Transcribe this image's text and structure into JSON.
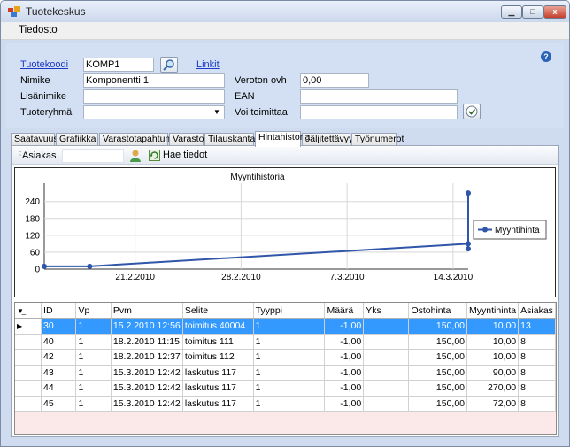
{
  "window": {
    "title": "Tuotekeskus",
    "minimize": "▁",
    "maximize": "□",
    "close": "x"
  },
  "menu": {
    "file": "Tiedosto"
  },
  "form": {
    "product_code_label": "Tuotekoodi",
    "product_code_value": "KOMP1",
    "links_label": "Linkit",
    "name_label": "Nimike",
    "name_value": "Komponentti 1",
    "extra_name_label": "Lisänimike",
    "extra_name_value": "",
    "group_label": "Tuoteryhmä",
    "group_value": "",
    "price_label": "Veroton ovh",
    "price_value": "0,00",
    "ean_label": "EAN",
    "ean_value": "",
    "supplier_label": "Voi toimittaa",
    "supplier_value": "",
    "help": "?"
  },
  "tabs": [
    "Saatavuus",
    "Grafiikka",
    "Varastotapahtumat",
    "Varastot",
    "Tilauskanta",
    "Hintahistoria",
    "Jäljitettävyys",
    "Työnumerot"
  ],
  "toolbar": {
    "customer_label": "Asiakas",
    "fetch_label": "Hae tiedot"
  },
  "chart_data": {
    "type": "line",
    "title": "Myyntihistoria",
    "x_labels": [
      "21.2.2010",
      "28.2.2010",
      "7.3.2010",
      "14.3.2010"
    ],
    "y_ticks": [
      0,
      60,
      120,
      180,
      240
    ],
    "ylim": [
      0,
      280
    ],
    "xlim": [
      "15.2.2010",
      "15.3.2010"
    ],
    "grid": true,
    "legend": "right",
    "series": [
      {
        "name": "Myyntihinta",
        "color": "#2f56a8",
        "points": [
          {
            "x": "15.2.2010",
            "y": 10
          },
          {
            "x": "18.2.2010",
            "y": 10
          },
          {
            "x": "15.3.2010",
            "y": 90
          },
          {
            "x": "15.3.2010",
            "y": 270
          },
          {
            "x": "15.3.2010",
            "y": 72
          }
        ]
      }
    ]
  },
  "table": {
    "columns": [
      "ID",
      "Vp",
      "Pvm",
      "Selite",
      "Tyyppi",
      "Määrä",
      "Yks",
      "Ostohinta",
      "Myyntihinta",
      "Asiakas"
    ],
    "rows": [
      [
        "30",
        "1",
        "15.2.2010 12:56",
        "toimitus 40004",
        "1",
        "-1,00",
        "",
        "150,00",
        "10,00",
        "13"
      ],
      [
        "40",
        "1",
        "18.2.2010 11:15",
        "toimitus 111",
        "1",
        "-1,00",
        "",
        "150,00",
        "10,00",
        "8"
      ],
      [
        "42",
        "1",
        "18.2.2010 12:37",
        "toimitus 112",
        "1",
        "-1,00",
        "",
        "150,00",
        "10,00",
        "8"
      ],
      [
        "43",
        "1",
        "15.3.2010 12:42",
        "laskutus 117",
        "1",
        "-1,00",
        "",
        "150,00",
        "90,00",
        "8"
      ],
      [
        "44",
        "1",
        "15.3.2010 12:42",
        "laskutus 117",
        "1",
        "-1,00",
        "",
        "150,00",
        "270,00",
        "8"
      ],
      [
        "45",
        "1",
        "15.3.2010 12:42",
        "laskutus 117",
        "1",
        "-1,00",
        "",
        "150,00",
        "72,00",
        "8"
      ]
    ],
    "selected_row": 0
  }
}
